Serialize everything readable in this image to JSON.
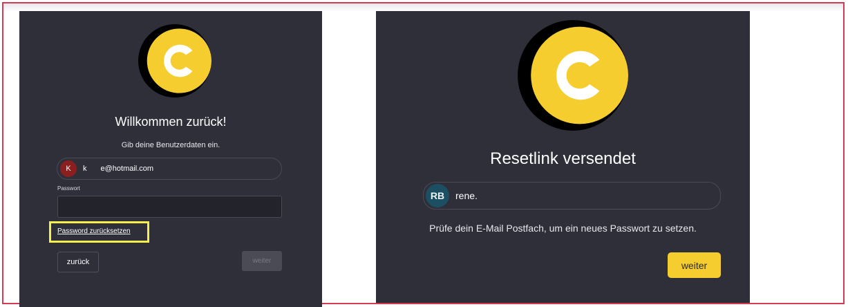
{
  "left_panel": {
    "title": "Willkommen zurück!",
    "subtitle": "Gib deine Benutzerdaten ein.",
    "user": {
      "avatar_initial": "K",
      "name_initial": "k",
      "email": "e@hotmail.com"
    },
    "password_label": "Passwort",
    "password_value": "",
    "reset_link": "Password zurücksetzen",
    "back_button": "zurück",
    "next_button": "weiter",
    "highlight_color": "#f7ef4a"
  },
  "right_panel": {
    "title": "Resetlink versendet",
    "user": {
      "avatar_initials": "RB",
      "name": "rene."
    },
    "message": "Prüfe dein E-Mail Postfach, um ein neues Passwort zu setzen.",
    "next_button": "weiter"
  },
  "colors": {
    "panel_bg": "#2f2f3a",
    "accent_yellow": "#f5cd2e",
    "frame_border": "#d23a52",
    "avatar_left": "#8b1f1f",
    "avatar_right": "#1d4f63"
  },
  "icons": {
    "logo": "c-logo-icon"
  }
}
